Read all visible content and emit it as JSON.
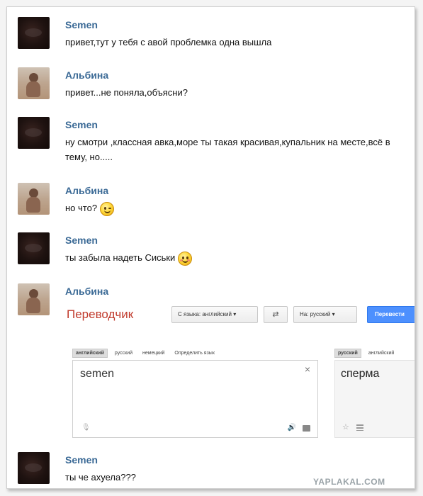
{
  "messages": [
    {
      "author": "Semen",
      "text": "привет,тут у тебя с авой проблемка одна вышла"
    },
    {
      "author": "Альбина",
      "text": "привет...не поняла,объясни?"
    },
    {
      "author": "Semen",
      "text": "ну смотри ,классная авка,море ты такая красивая,купальник на месте,всё в тему, но....."
    },
    {
      "author": "Альбина",
      "text": "но что?",
      "emoji": "wink-smiley-icon"
    },
    {
      "author": "Semen",
      "text": "ты забыла надеть Сиськи",
      "emoji": "blush-smiley-icon"
    },
    {
      "author": "Альбина",
      "text": ""
    },
    {
      "author": "Semen",
      "text": "ты че ахуела???"
    }
  ],
  "translator": {
    "title": "Переводчик",
    "from_label": "С языка: английский",
    "to_label": "На: русский",
    "translate_button": "Перевести",
    "source_tabs": [
      "английский",
      "русский",
      "немецкий",
      "Определить язык"
    ],
    "target_tabs": [
      "русский",
      "английский"
    ],
    "source_text": "semen",
    "result_text": "сперма"
  },
  "watermark": "YAPLAKAL.COM"
}
